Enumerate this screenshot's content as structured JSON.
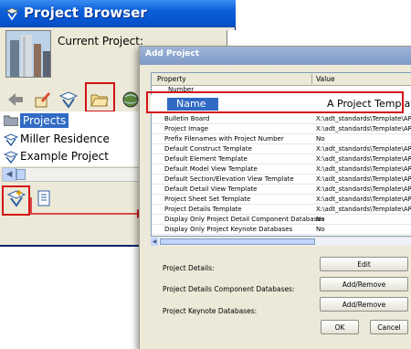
{
  "project_browser": {
    "title": "Project Browser",
    "current_project_label": "Current Project:",
    "projects_header": "Projects",
    "projects": [
      "Miller Residence",
      "Example Project"
    ]
  },
  "add_project": {
    "title": "Add Project",
    "columns": [
      "Property",
      "Value"
    ],
    "rows_top": [
      {
        "property": "Number",
        "value": ""
      }
    ],
    "name_row": {
      "property": "Name",
      "value": "A Project Template"
    },
    "rows": [
      {
        "property": "Bulletin Board",
        "value": "X:\\adt_standards\\Template\\ARCH"
      },
      {
        "property": "Project Image",
        "value": "X:\\adt_standards\\Template\\ARCH"
      },
      {
        "property": "Prefix Filenames with Project Number",
        "value": "No"
      },
      {
        "property": "Default Construct Template",
        "value": "X:\\adt_standards\\Template\\ARCH"
      },
      {
        "property": "Default Element Template",
        "value": "X:\\adt_standards\\Template\\ARCH"
      },
      {
        "property": "Default Model View Template",
        "value": "X:\\adt_standards\\Template\\ARCH"
      },
      {
        "property": "Default Section/Elevation View Template",
        "value": "X:\\adt_standards\\Template\\ARCH"
      },
      {
        "property": "Default Detail View Template",
        "value": "X:\\adt_standards\\Template\\ARCH"
      },
      {
        "property": "Project Sheet Set Template",
        "value": "X:\\adt_standards\\Template\\ARCH"
      },
      {
        "property": "Project Details Template",
        "value": "X:\\adt_standards\\Template\\ARCH"
      },
      {
        "property": "Display Only Project Detail Component Databases",
        "value": "No"
      },
      {
        "property": "Display Only Project Keynote Databases",
        "value": "No"
      }
    ],
    "fields": [
      {
        "label": "Project Details:",
        "button": "Edit"
      },
      {
        "label": "Project Details Component Databases:",
        "button": "Add/Remove"
      },
      {
        "label": "Project Keynote Databases:",
        "button": "Add/Remove"
      }
    ],
    "ok_label": "OK",
    "cancel_label": "Cancel"
  },
  "colors": {
    "highlight_red": "#d31418",
    "selection_blue": "#316ac5",
    "titlebar_blue": "#0a5fd8"
  }
}
